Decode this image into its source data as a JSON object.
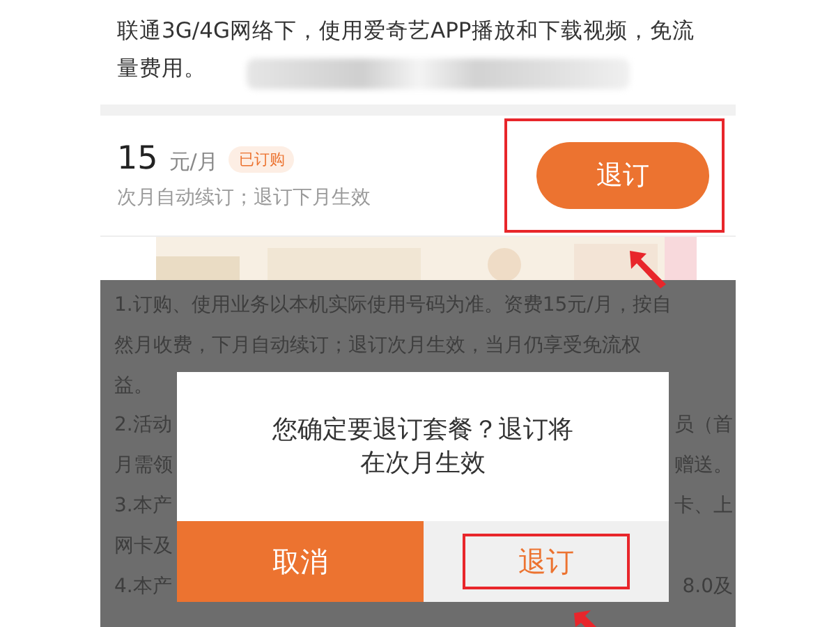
{
  "description": {
    "text": "联通3G/4G网络下，使用爱奇艺APP播放和下载视频，免流量费用。",
    "redacted": true
  },
  "plan": {
    "price": "15",
    "unit": "元/月",
    "badge": "已订购",
    "note": "次月自动续订；退订下月生效",
    "button": {
      "label": "退订",
      "highlighted": true
    }
  },
  "rules_lines": [
    {
      "left": "1.订购、使用业务以本机实际使用号码为准。资费15元/月，按自"
    },
    {
      "left": "然月收费，下月自动续订；退订次月生效，当月仍享受免流权"
    },
    {
      "left": "益。"
    },
    {
      "left": "2.活动",
      "right": "员（首"
    },
    {
      "left": "月需领",
      "right": "赠送。"
    },
    {
      "left": "3.本产",
      "right": "卡、上"
    },
    {
      "left": "网卡及"
    },
    {
      "left": "4.本产",
      "right": "8.0及"
    }
  ],
  "dialog": {
    "message": "您确定要退订套餐？退订将在次月生效",
    "buttons": [
      {
        "label": "取消",
        "kind": "cancel",
        "highlighted": false
      },
      {
        "label": "退订",
        "kind": "confirm",
        "highlighted": true
      }
    ]
  }
}
